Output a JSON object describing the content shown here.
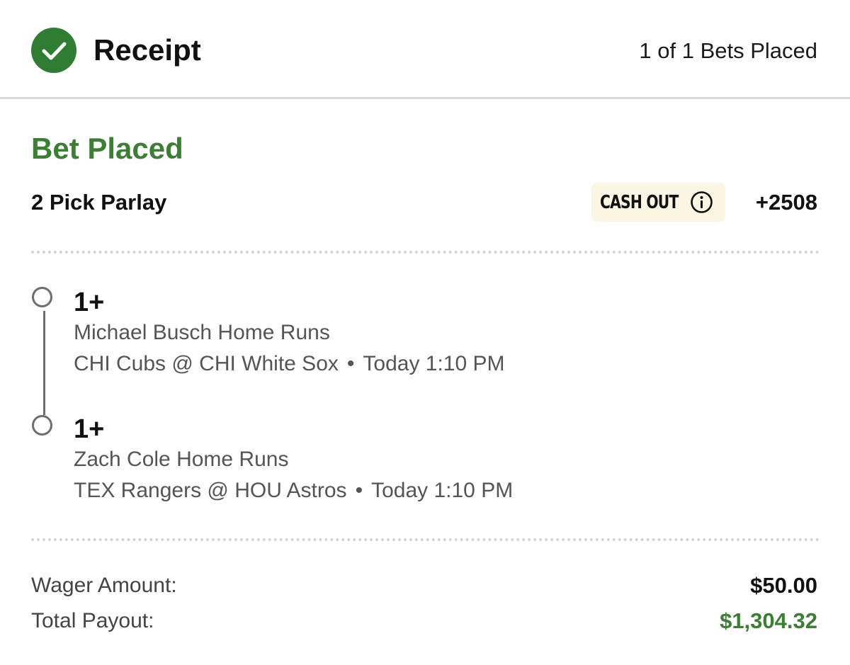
{
  "header": {
    "title": "Receipt",
    "bets_placed": "1 of 1 Bets Placed",
    "icon": "check-circle-icon"
  },
  "bet": {
    "status": "Bet Placed",
    "type": "2 Pick Parlay",
    "cashout_label": "CASH OUT",
    "odds": "+2508",
    "legs": [
      {
        "line": "1+",
        "market": "Michael Busch Home Runs",
        "matchup": "CHI Cubs @ CHI White Sox",
        "time": "Today 1:10 PM"
      },
      {
        "line": "1+",
        "market": "Zach Cole Home Runs",
        "matchup": "TEX Rangers @ HOU Astros",
        "time": "Today 1:10 PM"
      }
    ]
  },
  "summary": {
    "wager_label": "Wager Amount:",
    "wager_value": "$50.00",
    "payout_label": "Total Payout:",
    "payout_value": "$1,304.32"
  },
  "colors": {
    "accent_green": "#3b7f32",
    "check_green": "#2f7d32",
    "cashout_bg": "#fbf6e1"
  }
}
